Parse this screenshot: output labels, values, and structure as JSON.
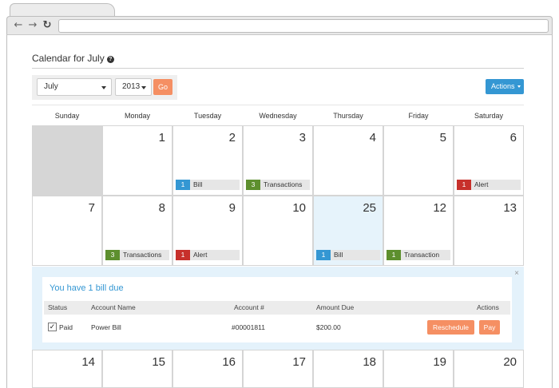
{
  "page": {
    "title": "Calendar for July",
    "help_icon": "question-circle-icon"
  },
  "filters": {
    "month": "July",
    "year": "2013",
    "go_label": "Go",
    "actions_label": "Actions"
  },
  "days_of_week": [
    "Sunday",
    "Monday",
    "Tuesday",
    "Wednesday",
    "Thursday",
    "Friday",
    "Saturday"
  ],
  "weeks": [
    [
      {
        "day": "",
        "empty": true
      },
      {
        "day": "1"
      },
      {
        "day": "2",
        "event": {
          "count": "1",
          "label": "Bill",
          "type": "bill"
        }
      },
      {
        "day": "3",
        "event": {
          "count": "3",
          "label": "Transactions",
          "type": "trans"
        }
      },
      {
        "day": "4"
      },
      {
        "day": "5"
      },
      {
        "day": "6",
        "event": {
          "count": "1",
          "label": "Alert",
          "type": "alert"
        }
      }
    ],
    [
      {
        "day": "7"
      },
      {
        "day": "8",
        "event": {
          "count": "3",
          "label": "Transactions",
          "type": "trans"
        }
      },
      {
        "day": "9",
        "event": {
          "count": "1",
          "label": "Alert",
          "type": "alert"
        }
      },
      {
        "day": "10"
      },
      {
        "day": "25",
        "today": true,
        "event": {
          "count": "1",
          "label": "Bill",
          "type": "bill"
        }
      },
      {
        "day": "12",
        "event": {
          "count": "1",
          "label": "Transaction",
          "type": "trans"
        }
      },
      {
        "day": "13"
      }
    ],
    [
      {
        "day": "14"
      },
      {
        "day": "15"
      },
      {
        "day": "16"
      },
      {
        "day": "17"
      },
      {
        "day": "18"
      },
      {
        "day": "19"
      },
      {
        "day": "20"
      }
    ]
  ],
  "bill_panel": {
    "close": "×",
    "title": "You have 1 bill due",
    "columns": {
      "status": "Status",
      "account_name": "Account Name",
      "account_no": "Account #",
      "amount_due": "Amount Due",
      "actions": "Actions"
    },
    "row": {
      "checked": "✓",
      "status": "Paid",
      "account_name": "Power Bill",
      "account_no": "#00001811",
      "amount_due": "$200.00",
      "reschedule_label": "Reschedule",
      "pay_label": "Pay"
    }
  },
  "colors": {
    "bill": "#3497d3",
    "transactions": "#5d8f2e",
    "alert": "#c7302b",
    "accent_orange": "#f58f63",
    "today_bg": "#e6f3fb"
  }
}
